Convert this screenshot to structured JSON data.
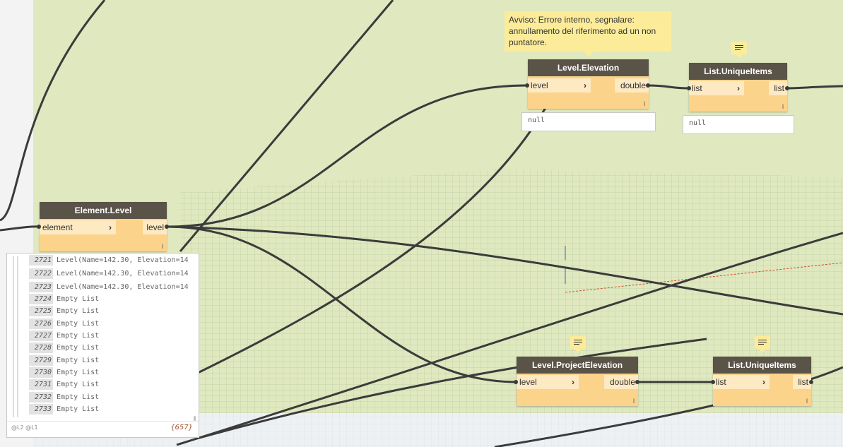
{
  "colors": {
    "canvas_green": "#dfe8bf",
    "node_header": "#5a5348",
    "node_body": "#fbd38a",
    "wire": "#3b3b3b",
    "tooltip": "#fcec9a"
  },
  "warning": {
    "text": "Avviso: Errore interno, segnalare: annullamento del riferimento ad un non puntatore."
  },
  "nodes": {
    "element_level": {
      "title": "Element.Level",
      "input": "element",
      "output": "level",
      "lacing": "l"
    },
    "level_elevation": {
      "title": "Level.Elevation",
      "input": "level",
      "output": "double",
      "lacing": "l",
      "preview": "null"
    },
    "unique_items_top": {
      "title": "List.UniqueItems",
      "input": "list",
      "output": "list",
      "lacing": "l",
      "preview": "null"
    },
    "level_project_elevation": {
      "title": "Level.ProjectElevation",
      "input": "level",
      "output": "double",
      "lacing": "l"
    },
    "unique_items_bottom": {
      "title": "List.UniqueItems",
      "input": "list",
      "output": "list",
      "lacing": "l"
    }
  },
  "list_preview": {
    "rows": [
      {
        "index": "2721",
        "value": "Level(Name=142.30, Elevation=14"
      },
      {
        "index": "2722",
        "value": "Level(Name=142.30, Elevation=14"
      },
      {
        "index": "2723",
        "value": "Level(Name=142.30, Elevation=14"
      },
      {
        "index": "2724",
        "value": "Empty List"
      },
      {
        "index": "2725",
        "value": "Empty List"
      },
      {
        "index": "2726",
        "value": "Empty List"
      },
      {
        "index": "2727",
        "value": "Empty List"
      },
      {
        "index": "2728",
        "value": "Empty List"
      },
      {
        "index": "2729",
        "value": "Empty List"
      },
      {
        "index": "2730",
        "value": "Empty List"
      },
      {
        "index": "2731",
        "value": "Empty List"
      },
      {
        "index": "2732",
        "value": "Empty List"
      },
      {
        "index": "2733",
        "value": "Empty List"
      }
    ],
    "levels": "@L2 @L1",
    "count": "{657}"
  }
}
